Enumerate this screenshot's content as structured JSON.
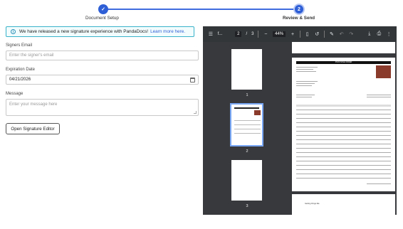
{
  "stepper": {
    "step1_label": "Document Setup",
    "step2_label": "Review & Send",
    "step2_number": "2",
    "accent": "#2f5fd6"
  },
  "banner": {
    "text": "We have released a new signature experience with PandaDocs!",
    "link": "Learn more here."
  },
  "form": {
    "signers_label": "Signers Email",
    "signers_placeholder": "Enter the signer's email",
    "expiration_label": "Expiration Date",
    "expiration_value": "04/21/2026",
    "message_label": "Message",
    "message_placeholder": "Enter your message here",
    "editor_button": "Open Signature Editor"
  },
  "viewer": {
    "filename": "f...",
    "page_current": "2",
    "page_sep": "/",
    "page_total": "3",
    "zoom": "44%",
    "thumbs": [
      {
        "number": "1"
      },
      {
        "number": "2"
      },
      {
        "number": "3"
      }
    ],
    "doc_header": "PURCHASE ORDER",
    "doc_footer": "Getting things like"
  }
}
